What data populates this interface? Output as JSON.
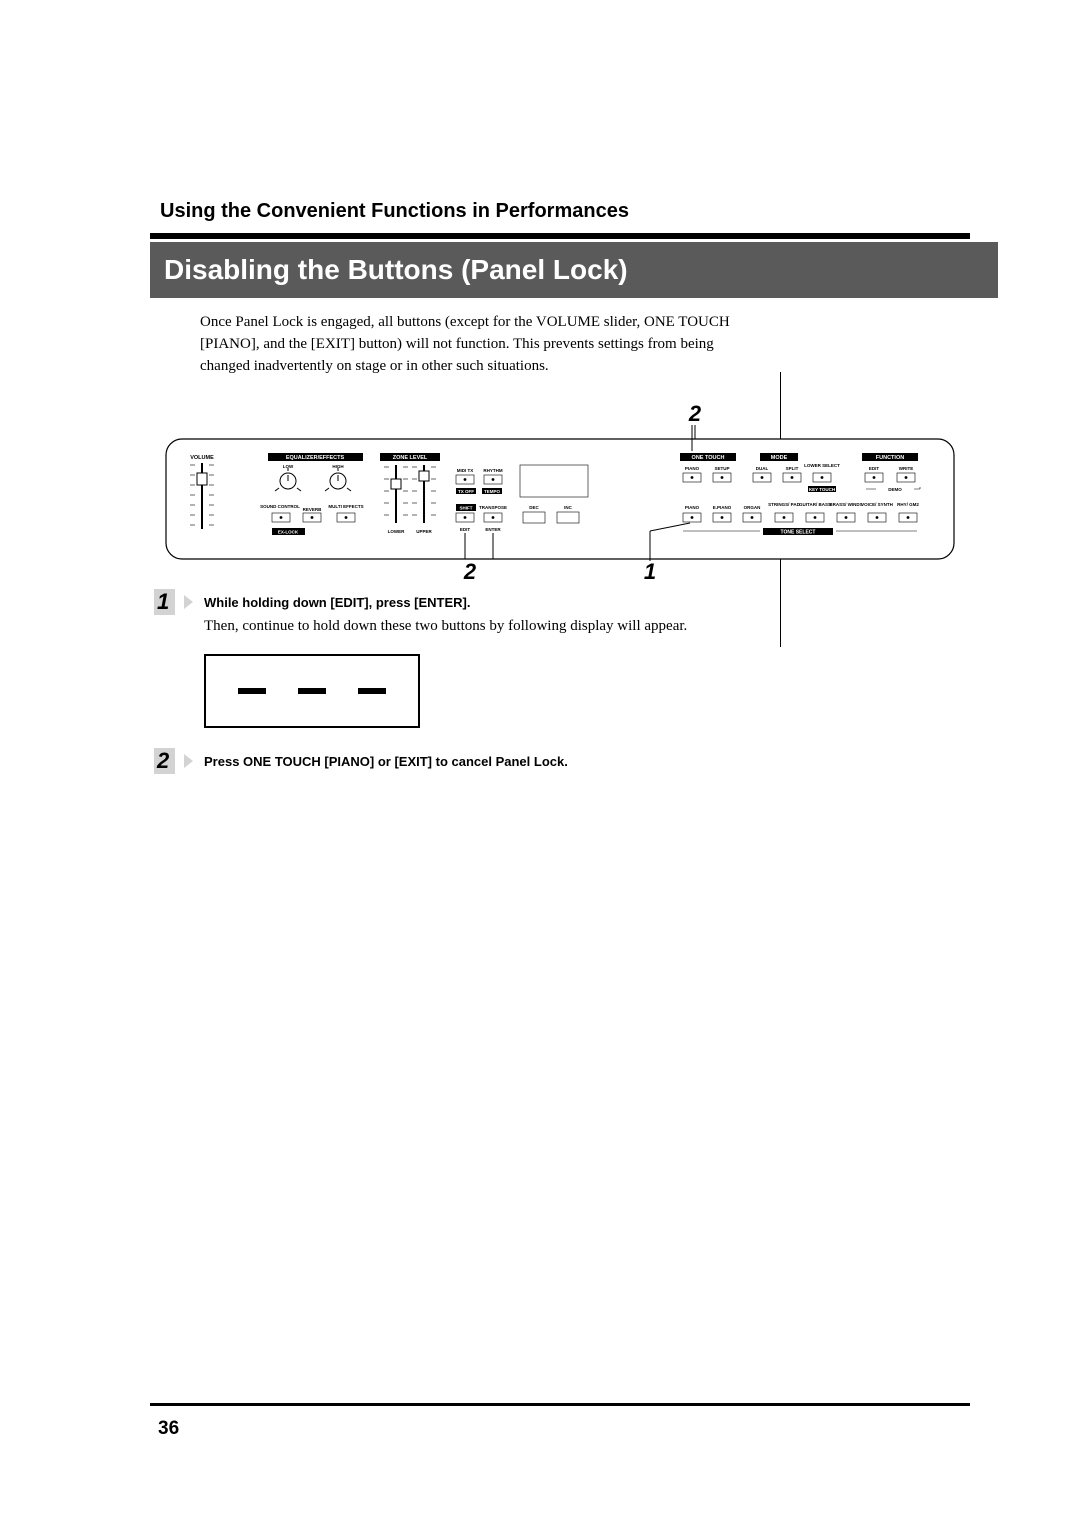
{
  "page_number": "36",
  "header": {
    "chapter": "Using the Convenient Functions in Performances"
  },
  "section": {
    "title": "Disabling the Buttons (Panel Lock)"
  },
  "intro": "Once Panel Lock is engaged, all buttons (except for the VOLUME slider, ONE TOUCH [PIANO], and the [EXIT] button) will not function. This prevents settings from being changed inadvertently on stage or in other such situations.",
  "callouts": {
    "top": "2",
    "bottom_left": "2",
    "bottom_center": "1"
  },
  "panel": {
    "volume_label": "VOLUME",
    "eq_header": "EQUALIZER/EFFECTS",
    "eq_low": "LOW",
    "eq_high": "HIGH",
    "sound_control": "SOUND\nCONTROL",
    "reverb": "REVERB",
    "multi_effects": "MULTI\nEFFECTS",
    "ex_lock": "EX-LOCK",
    "zone_header": "ZONE LEVEL",
    "zone_lower": "LOWER",
    "zone_upper": "UPPER",
    "midi_tx": "MIDI TX",
    "rhythm": "RHYTHM",
    "tx_off": "TX OFF",
    "tempo": "TEMPO",
    "shift": "SHIFT",
    "transpose": "TRANSPOSE",
    "dec": "DEC",
    "inc": "INC",
    "edit": "EDIT",
    "enter": "ENTER",
    "one_touch_header": "ONE TOUCH",
    "ot_piano": "PIANO",
    "ot_setup": "SETUP",
    "mode_header": "MODE",
    "mode_dual": "DUAL",
    "mode_split": "SPLIT",
    "mode_lower": "LOWER\nSELECT",
    "key_touch": "KEY TOUCH",
    "function_header": "FUNCTION",
    "fn_edit": "EDIT",
    "fn_write": "WRITE",
    "fn_demo": "DEMO",
    "tone_select": "TONE SELECT",
    "tones": {
      "piano": "PIANO",
      "epiano": "E.PIANO",
      "organ": "ORGAN",
      "strings": "STRINGS/\nPAD",
      "guitar": "GUITAR/\nBASS",
      "brass": "BRASS/\nWINDS",
      "voice": "VOICE/\nSYNTH",
      "rhy": "RHY/\nGM2"
    }
  },
  "steps": [
    {
      "n": "1",
      "bold": "While holding down [EDIT], press [ENTER].",
      "text": "Then, continue to hold down these two buttons by following display will appear."
    },
    {
      "n": "2",
      "bold": "Press ONE TOUCH [PIANO] or [EXIT] to cancel Panel Lock."
    }
  ]
}
